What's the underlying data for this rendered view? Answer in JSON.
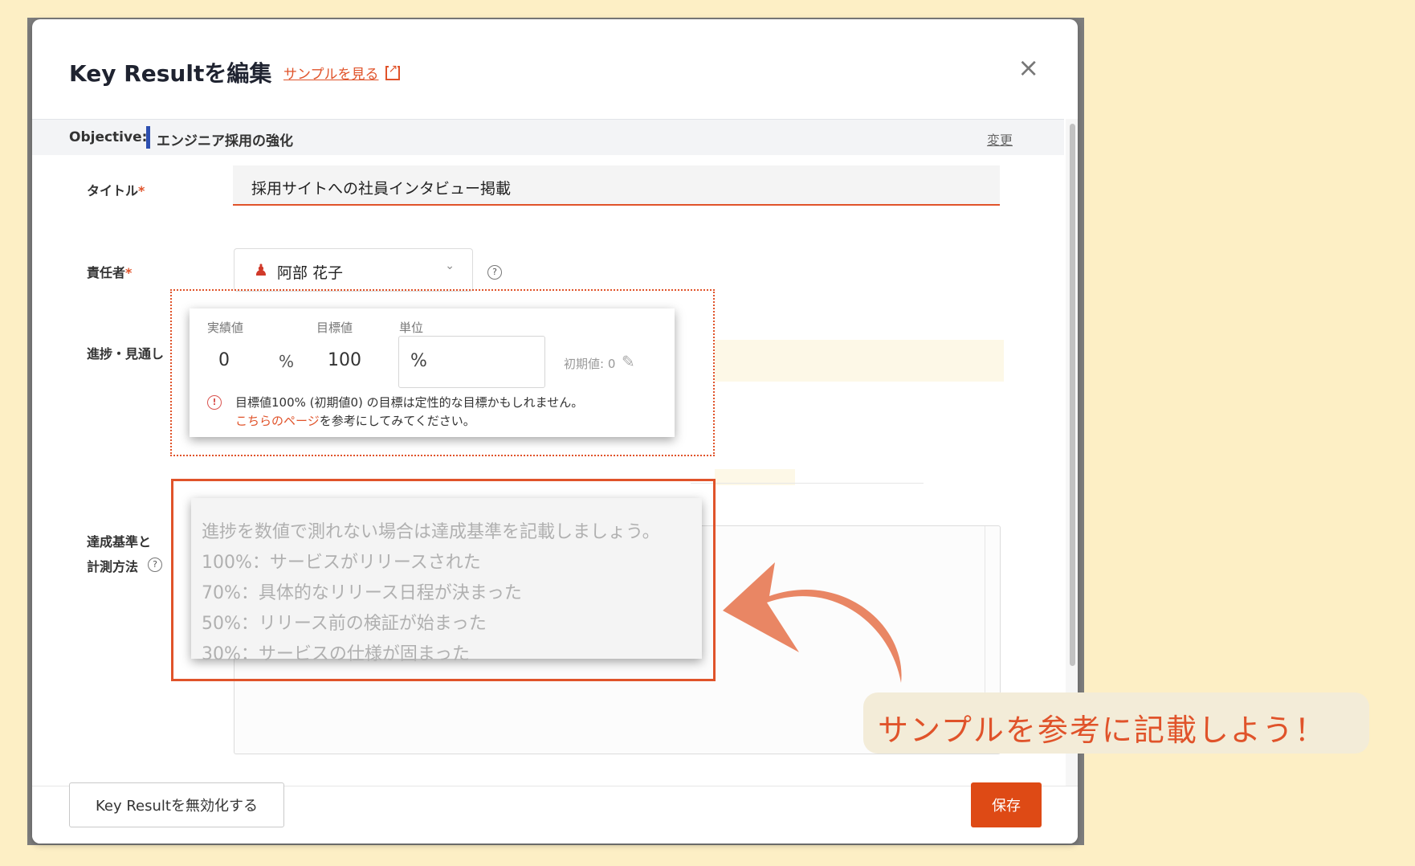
{
  "modal": {
    "title": "Key Resultを編集",
    "sample_link": "サンプルを見る",
    "close_label": "×"
  },
  "objective": {
    "label": "Objective:",
    "value": "エンジニア採用の強化",
    "change_label": "変更"
  },
  "fields": {
    "title_label": "タイトル",
    "title_value": "採用サイトへの社員インタビュー掲載",
    "owner_label": "責任者",
    "owner_value": "阿部 花子",
    "progress_label": "進捗・見通し",
    "criteria_label_line1": "達成基準と",
    "criteria_label_line2": "計測方法",
    "required_mark": "*"
  },
  "progress": {
    "actual_label": "実績値",
    "actual_value": "0",
    "actual_unit": "%",
    "target_label": "目標値",
    "target_value": "100",
    "unit_label": "単位",
    "unit_value": "%",
    "initial_text": "初期値: 0",
    "warning_text": "目標値100% (初期値0) の目標は定性的な目標かもしれません。",
    "warning_link": "こちらのページ",
    "warning_suffix": "を参考にしてみてください。"
  },
  "criteria_placeholder": [
    "進捗を数値で測れない場合は達成基準を記載しましょう。",
    "100%：サービスがリリースされた",
    "70%：具体的なリリース日程が決まった",
    "50%：リリース前の検証が始まった",
    "30%：サービスの仕様が固まった"
  ],
  "footer": {
    "disable_button": "Key Resultを無効化する",
    "save_button": "保存"
  },
  "callout": {
    "text": "サンプルを参考に記載しよう！"
  },
  "colors": {
    "accent": "#e0532a",
    "save_button": "#de4a15",
    "objective_bar": "#2d4fb0",
    "page_background": "#fdefc5"
  }
}
